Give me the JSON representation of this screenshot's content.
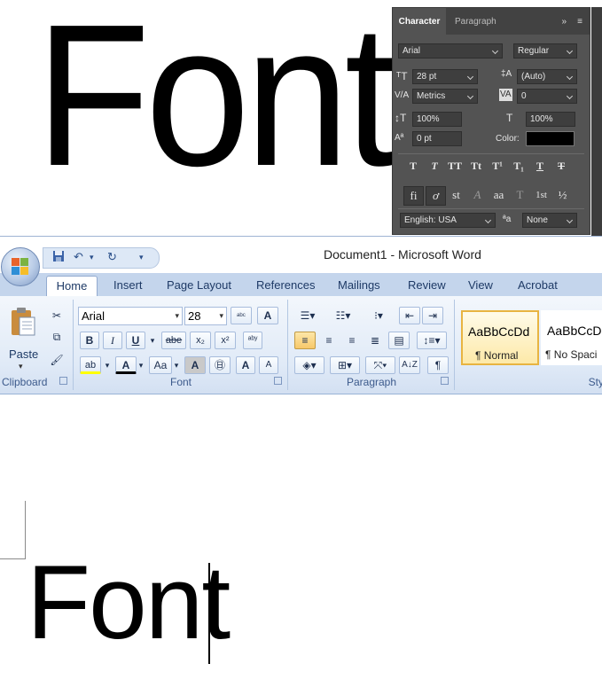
{
  "canvas": {
    "big_text": "Font"
  },
  "ps_panel": {
    "tabs": {
      "character": "Character",
      "paragraph": "Paragraph"
    },
    "collapse_icon": "»",
    "menu_icon": "≡",
    "font_family": "Arial",
    "font_style": "Regular",
    "font_size": "28 pt",
    "leading": "(Auto)",
    "kerning": "Metrics",
    "tracking": "0",
    "vertical_scale": "100%",
    "horizontal_scale": "100%",
    "baseline_shift": "0 pt",
    "color_label": "Color:",
    "color_value": "#000000",
    "style_buttons": [
      "T",
      "T",
      "TT",
      "Tt",
      "T¹",
      "T₁",
      "T",
      "T"
    ],
    "opentype_buttons": [
      "fi",
      "ơ",
      "st",
      "A",
      "aa",
      "T",
      "1st",
      "½"
    ],
    "language": "English: USA",
    "aa_icon": "ªa",
    "antialias": "None"
  },
  "word": {
    "title": "Document1 - Microsoft Word",
    "qat": {
      "save": "💾",
      "undo": "↶",
      "undo_menu": "▾",
      "redo": "↻",
      "customize": "▾"
    },
    "tabs": [
      "Home",
      "Insert",
      "Page Layout",
      "References",
      "Mailings",
      "Review",
      "View",
      "Acrobat"
    ],
    "clipboard": {
      "paste": "Paste",
      "paste_arrow": "▾",
      "label": "Clipboard"
    },
    "font": {
      "name": "Arial",
      "size": "28",
      "bold": "B",
      "italic": "I",
      "underline": "U",
      "strike": "abe",
      "subscript": "x₂",
      "superscript": "x²",
      "change_case": "Aa",
      "grow": "A",
      "shrink": "A",
      "font_color": "A",
      "char_shading": "A",
      "clear": "aby",
      "highlight": "ab",
      "encircle": "㊐",
      "label": "Font"
    },
    "paragraph": {
      "label": "Paragraph",
      "show_marks": "¶",
      "sort": "A↓Z"
    },
    "styles": [
      {
        "sample": "AaBbCcDd",
        "name": "¶ Normal"
      },
      {
        "sample": "AaBbCcDd",
        "name": "¶ No Spaci"
      }
    ],
    "styles_label": "Sty"
  },
  "document": {
    "text": "Font"
  }
}
